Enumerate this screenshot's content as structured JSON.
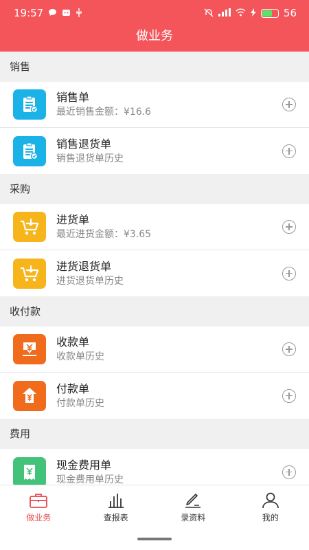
{
  "status_bar": {
    "time": "19:57",
    "battery_level": "56",
    "icons": [
      "chat-bubble-icon",
      "notification-icon",
      "usb-icon",
      "mute-icon",
      "signal-icon",
      "wifi-icon",
      "charging-icon"
    ]
  },
  "header": {
    "title": "做业务"
  },
  "sections": [
    {
      "title": "销售",
      "items": [
        {
          "title": "销售单",
          "subtitle": "最近销售金额：¥16.6",
          "icon": "clipboard-check-icon",
          "color": "#1bb2e8"
        },
        {
          "title": "销售退货单",
          "subtitle": "销售退货单历史",
          "icon": "clipboard-check-icon",
          "color": "#1bb2e8"
        }
      ]
    },
    {
      "title": "采购",
      "items": [
        {
          "title": "进货单",
          "subtitle": "最近进货金额：¥3.65",
          "icon": "cart-in-icon",
          "color": "#f7b51c"
        },
        {
          "title": "进货退货单",
          "subtitle": "进货退货单历史",
          "icon": "cart-in-icon",
          "color": "#f7b51c"
        }
      ]
    },
    {
      "title": "收付款",
      "items": [
        {
          "title": "收款单",
          "subtitle": "收款单历史",
          "icon": "yuan-down-icon",
          "color": "#f16b1d"
        },
        {
          "title": "付款单",
          "subtitle": "付款单历史",
          "icon": "yuan-up-icon",
          "color": "#f16b1d"
        }
      ]
    },
    {
      "title": "费用",
      "items": [
        {
          "title": "现金费用单",
          "subtitle": "现金费用单历史",
          "icon": "receipt-yuan-icon",
          "color": "#43c27a"
        }
      ]
    }
  ],
  "tabs": [
    {
      "label": "做业务",
      "icon": "briefcase-icon",
      "active": true
    },
    {
      "label": "查报表",
      "icon": "bar-chart-icon",
      "active": false
    },
    {
      "label": "录资料",
      "icon": "edit-icon",
      "active": false
    },
    {
      "label": "我的",
      "icon": "person-icon",
      "active": false
    }
  ],
  "colors": {
    "brand": "#f4555a",
    "active_tab": "#e8474c"
  }
}
